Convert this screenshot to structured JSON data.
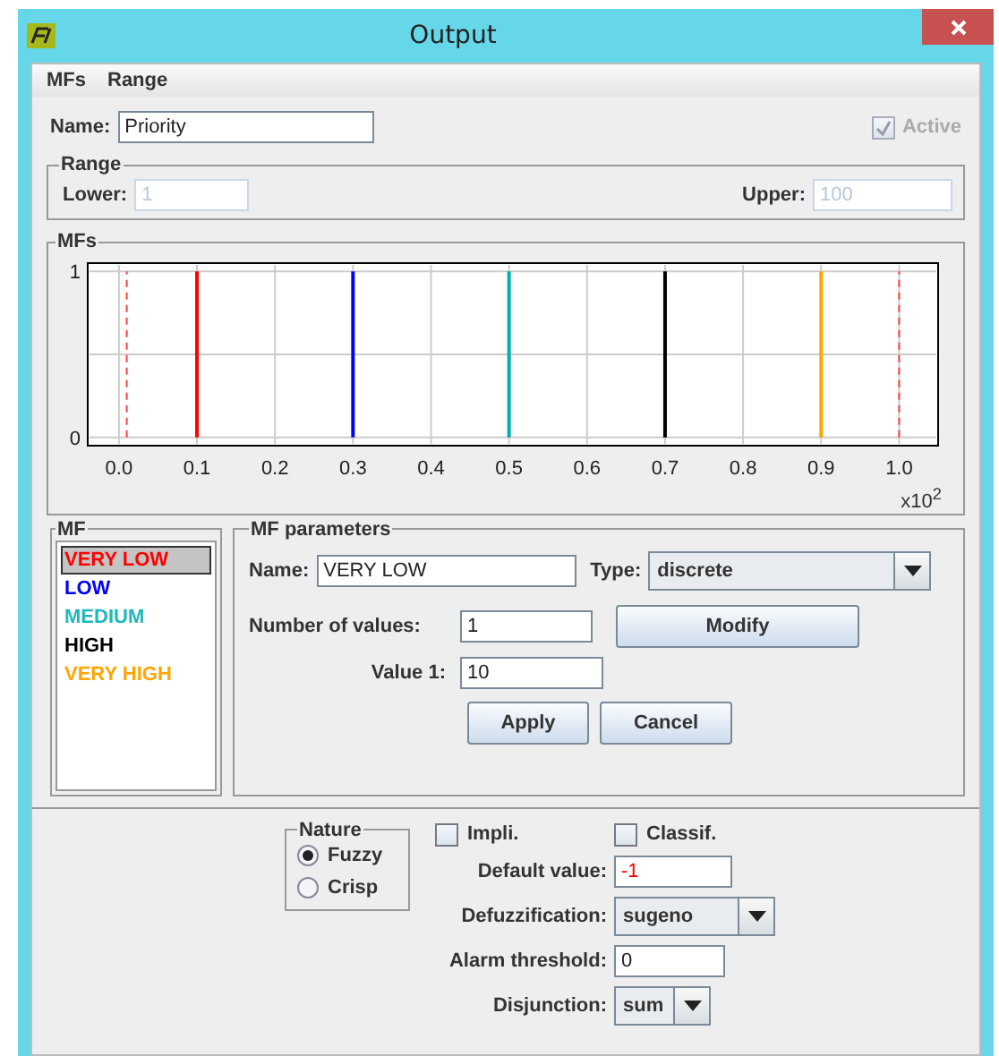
{
  "window": {
    "title": "Output"
  },
  "menu": [
    {
      "label": "MFs"
    },
    {
      "label": "Range"
    }
  ],
  "name": {
    "label": "Name:",
    "value": "Priority"
  },
  "active": {
    "label": "Active",
    "checked": true,
    "disabled": true
  },
  "range": {
    "title": "Range",
    "disabled": true,
    "lower": {
      "label": "Lower:",
      "value": "1"
    },
    "upper": {
      "label": "Upper:",
      "value": "100"
    }
  },
  "mfs_panel": {
    "title": "MFs",
    "chart_data": {
      "type": "line",
      "xlabel": "x10$^{2}$",
      "xlim": [
        -0.04,
        1.05
      ],
      "ylim": [
        -0.05,
        1.05
      ],
      "xticks": [
        {
          "value": 0,
          "label": "0.0"
        },
        {
          "value": 0.1,
          "label": "0.1"
        },
        {
          "value": 0.2,
          "label": "0.2"
        },
        {
          "value": 0.3,
          "label": "0.3"
        },
        {
          "value": 0.4,
          "label": "0.4"
        },
        {
          "value": 0.5,
          "label": "0.5"
        },
        {
          "value": 0.6,
          "label": "0.6"
        },
        {
          "value": 0.7,
          "label": "0.7"
        },
        {
          "value": 0.8,
          "label": "0.8"
        },
        {
          "value": 0.9,
          "label": "0.9"
        },
        {
          "value": 1,
          "label": "1.0"
        }
      ],
      "yticks": [
        0,
        1
      ],
      "series": [
        {
          "color": "#ff0000",
          "x": [
            0.1,
            0.1
          ],
          "values": [
            0,
            1
          ]
        },
        {
          "color": "#0000ff",
          "x": [
            0.3,
            0.3
          ],
          "values": [
            0,
            1
          ]
        },
        {
          "color": "#00b0b0",
          "x": [
            0.5,
            0.5
          ],
          "values": [
            0,
            1
          ]
        },
        {
          "color": "#000000",
          "x": [
            0.7,
            0.7
          ],
          "values": [
            0,
            1
          ]
        },
        {
          "color": "#ffa500",
          "x": [
            0.9,
            0.9
          ],
          "values": [
            0,
            1
          ]
        },
        {
          "color": "#ff4040",
          "line_style": "dashed",
          "x": [
            0.01,
            0.01
          ],
          "values": [
            0,
            1
          ]
        },
        {
          "color": "#ff4040",
          "line_style": "dashed",
          "x": [
            1.0,
            1.0
          ],
          "values": [
            0,
            1
          ]
        }
      ],
      "grid": true
    }
  },
  "mf_list": {
    "title": "MF",
    "items": [
      {
        "label": "VERY LOW",
        "color": "#ff0000",
        "selected": true
      },
      {
        "label": "LOW",
        "color": "#0000ff",
        "selected": false
      },
      {
        "label": "MEDIUM",
        "color": "#20b8b8",
        "selected": false
      },
      {
        "label": "HIGH",
        "color": "#000000",
        "selected": false
      },
      {
        "label": "VERY HIGH",
        "color": "#ffa500",
        "selected": false
      }
    ]
  },
  "mf_parameters": {
    "title": "MF parameters",
    "name": {
      "label": "Name:",
      "value": "VERY LOW"
    },
    "type": {
      "label": "Type:",
      "value": "discrete"
    },
    "number_of_values": {
      "label": "Number of values:",
      "value": "1"
    },
    "modify": "Modify",
    "values": [
      {
        "label": "Value 1:",
        "value": "10"
      }
    ],
    "buttons": [
      {
        "label": "Apply"
      },
      {
        "label": "Cancel"
      }
    ]
  },
  "nature": {
    "title": "Nature",
    "options": [
      {
        "label": "Fuzzy",
        "selected": true
      },
      {
        "label": "Crisp",
        "selected": false
      }
    ]
  },
  "checkboxes": [
    {
      "label": "Impli.",
      "checked": false
    },
    {
      "label": "Classif.",
      "checked": false
    }
  ],
  "fields": [
    {
      "kind": "text",
      "label": "Default value:",
      "value": "-1",
      "invalid": true
    },
    {
      "kind": "select",
      "label": "Defuzzification:",
      "value": "sugeno"
    },
    {
      "kind": "text",
      "label": "Alarm threshold:",
      "value": "0",
      "invalid": false
    },
    {
      "kind": "select",
      "label": "Disjunction:",
      "value": "sum"
    }
  ]
}
